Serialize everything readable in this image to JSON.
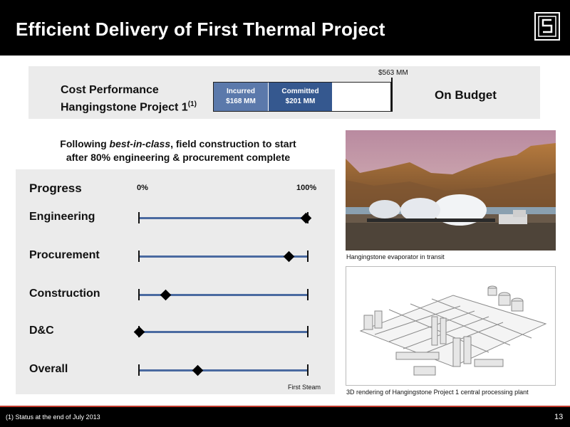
{
  "header": {
    "title": "Efficient Delivery of First Thermal Project"
  },
  "cost_performance": {
    "title_line1": "Cost  Performance",
    "title_line2": "Hangingstone Project 1",
    "footnote_ref": "(1)",
    "total_label": "$563 MM",
    "incurred_label": "Incurred",
    "incurred_value": "$168 MM",
    "committed_label": "Committed",
    "committed_value": "$201 MM",
    "status": "On Budget",
    "colors": {
      "incurred": "#5b79ab",
      "committed": "#35588f"
    }
  },
  "note": {
    "prefix": "Following ",
    "emphasis": "best-in-class",
    "line1_rest": ", field construction to start",
    "line2": "after 80% engineering & procurement complete"
  },
  "progress": {
    "title": "Progress",
    "start_label": "0%",
    "end_label": "100%",
    "end_marker_label": "First Steam",
    "rows": [
      {
        "label": "Engineering",
        "percent": 99
      },
      {
        "label": "Procurement",
        "percent": 89
      },
      {
        "label": "Construction",
        "percent": 16
      },
      {
        "label": "D&C",
        "percent": 0
      },
      {
        "label": "Overall",
        "percent": 35
      }
    ]
  },
  "photos": {
    "top_caption": "Hangingstone evaporator in transit",
    "bottom_caption": "3D  rendering of  Hangingstone Project 1 central processing plant"
  },
  "footer": {
    "footnote": "(1)  Status at the end of July 2013",
    "page_number": "13"
  }
}
